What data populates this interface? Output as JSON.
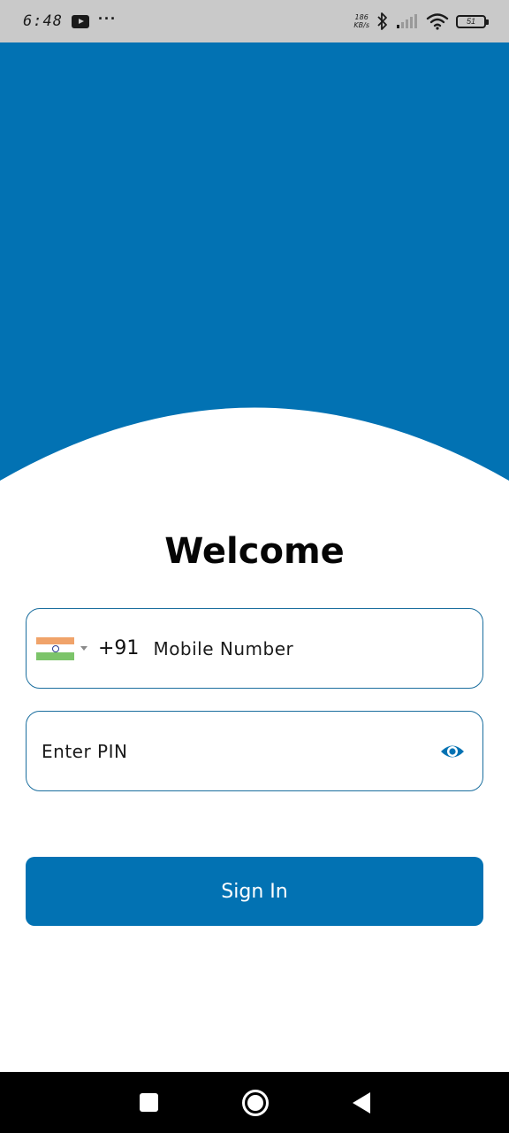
{
  "status_bar": {
    "time": "6:48",
    "net_speed_value": "186",
    "net_speed_unit": "KB/s",
    "battery_level": "51",
    "icons": [
      "youtube-icon",
      "more-dots-icon",
      "bluetooth-icon",
      "signal-icon",
      "wifi-icon",
      "battery-icon"
    ]
  },
  "colors": {
    "brand_blue": "#0272b3",
    "field_border": "#1a6e9e",
    "status_bar_bg": "#c9c9c9"
  },
  "login": {
    "title": "Welcome",
    "phone": {
      "country_flag": "india-flag-icon",
      "country_code": "+91",
      "placeholder": "Mobile Number",
      "value": ""
    },
    "pin": {
      "placeholder": "Enter PIN",
      "value": "",
      "toggle_icon": "eye-icon"
    },
    "submit_label": "Sign In"
  },
  "nav_bar": {
    "icons": [
      "recents-square-icon",
      "home-circle-icon",
      "back-triangle-icon"
    ]
  }
}
